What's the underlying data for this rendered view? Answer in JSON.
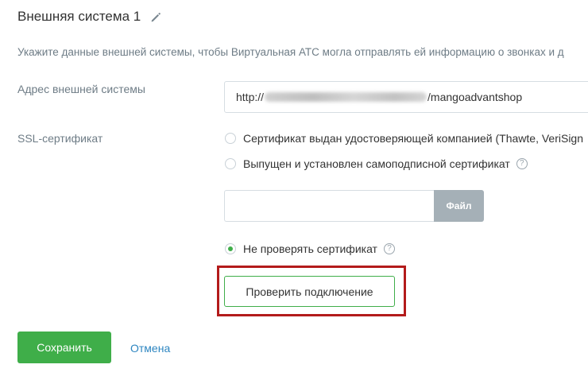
{
  "header": {
    "title": "Внешняя система 1",
    "edit_icon": "pencil-icon"
  },
  "description": "Укажите данные внешней системы, чтобы Виртуальная АТС могла отправлять ей информацию о звонках и д",
  "address": {
    "label": "Адрес внешней системы",
    "value_prefix": "http://",
    "value_suffix": "/mangoadvantshop"
  },
  "ssl": {
    "label": "SSL-сертификат",
    "options": [
      {
        "label": "Сертификат выдан удостоверяющей компанией (Thawte, VeriSign",
        "checked": false,
        "help": false
      },
      {
        "label": "Выпущен и установлен самоподписной сертификат",
        "checked": false,
        "help": true
      },
      {
        "label": "Не проверять сертификат",
        "checked": true,
        "help": true
      }
    ],
    "help_glyph": "?",
    "file_button": "Файл"
  },
  "actions": {
    "check_connection": "Проверить подключение",
    "save": "Сохранить",
    "cancel": "Отмена"
  },
  "colors": {
    "accent_green": "#3fae49",
    "highlight_red": "#b31b1b",
    "link_blue": "#2e86c1",
    "file_button_gray": "#a5b0b7"
  }
}
